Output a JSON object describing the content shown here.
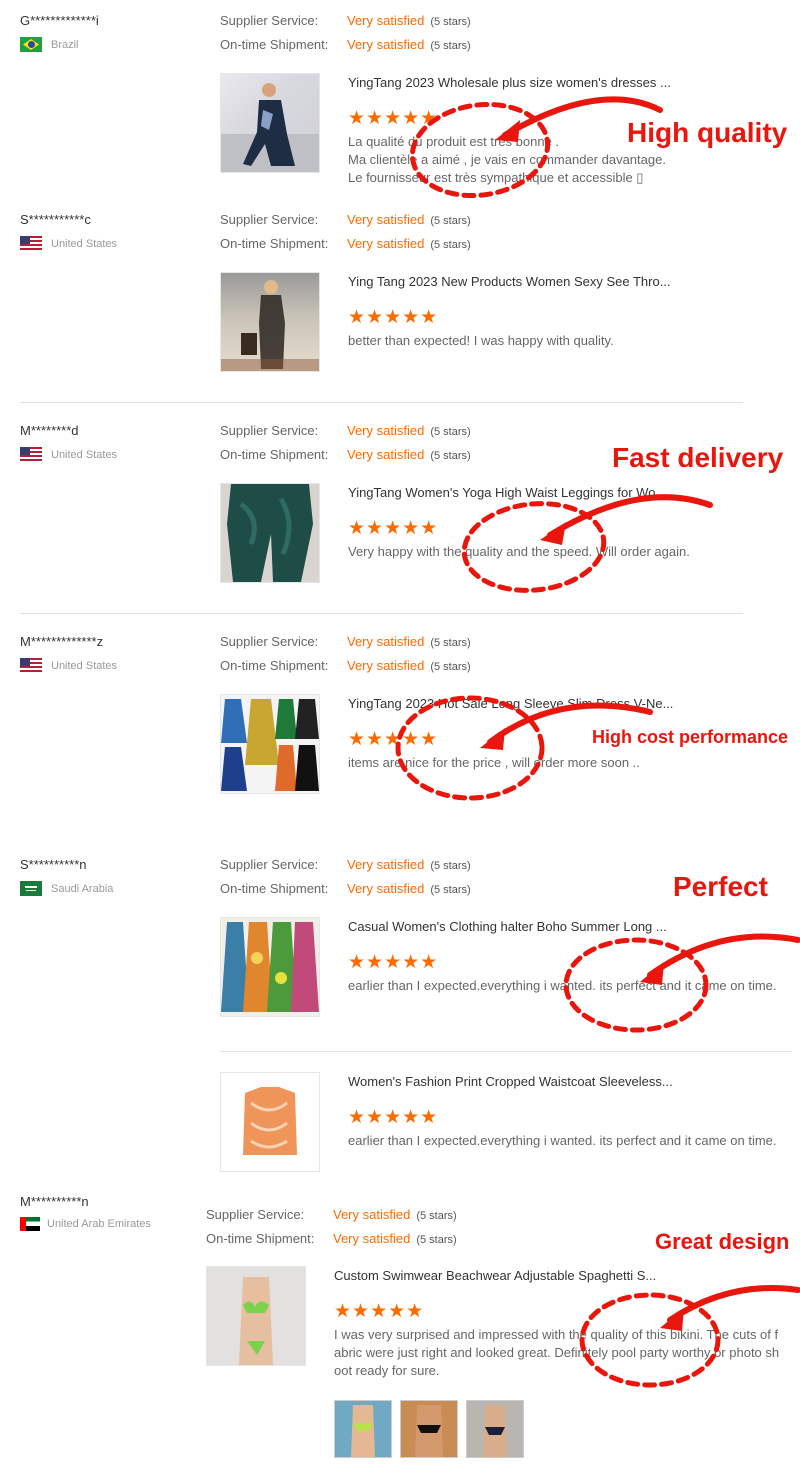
{
  "labels": {
    "supplier_service": "Supplier Service:",
    "ontime_shipment": "On-time Shipment:",
    "rating_value": "Very satisfied",
    "rating_stars": "(5 stars)",
    "stars_glyph": "★★★★★"
  },
  "reviews": [
    {
      "buyer": "G*************i",
      "country": "Brazil",
      "flag_icon": "brazil-flag-icon",
      "products": [
        {
          "title": "YingTang 2023 Wholesale plus size women's dresses ...",
          "comment": "La qualité du produit est très bonne .\nMa clientèle a aimé , je vais en commander davantage.\nLe fournisseur est très sympathique et accessible ▯"
        }
      ]
    },
    {
      "buyer": "S***********c",
      "country": "United States",
      "flag_icon": "usa-flag-icon",
      "products": [
        {
          "title": "Ying Tang 2023 New Products Women Sexy See Thro...",
          "comment": "better than expected! I was happy with quality."
        }
      ]
    },
    {
      "buyer": "M********d",
      "country": "United States",
      "flag_icon": "usa-flag-icon",
      "products": [
        {
          "title": "YingTang Women's Yoga High Waist Leggings for Wo...",
          "comment": "Very happy with the quality and the speed. Will order again."
        }
      ]
    },
    {
      "buyer": "M*************z",
      "country": "United States",
      "flag_icon": "usa-flag-icon",
      "products": [
        {
          "title": "YingTang 2023 Hot Sale Long Sleeve Slim Dress V-Ne...",
          "comment": "items are nice for the price , will order more soon .."
        }
      ]
    },
    {
      "buyer": "S**********n",
      "country": "Saudi Arabia",
      "flag_icon": "saudi-arabia-flag-icon",
      "products": [
        {
          "title": "Casual Women's Clothing halter Boho Summer Long ...",
          "comment": "earlier than I expected.everything i wanted. its perfect and it came on time."
        },
        {
          "title": "Women's Fashion Print Cropped Waistcoat Sleeveless...",
          "comment": "earlier than I expected.everything i wanted. its perfect and it came on time."
        }
      ]
    },
    {
      "buyer": "M**********n",
      "country": "United Arab Emirates",
      "flag_icon": "uae-flag-icon",
      "products": [
        {
          "title": "Custom Swimwear Beachwear Adjustable Spaghetti S...",
          "comment": "I was very surprised and impressed with the quality of this bikini. The cuts of fabric were just right and looked great. Definitely pool party worthy or photo shoot ready for sure."
        }
      ]
    }
  ],
  "annotations": {
    "a1": "High quality",
    "a2": "Fast delivery",
    "a3": "High cost performance",
    "a4": "Perfect",
    "a5": "Great design"
  },
  "colors": {
    "rating_orange": "#ff6a00",
    "annotation_red": "#e8160c"
  }
}
